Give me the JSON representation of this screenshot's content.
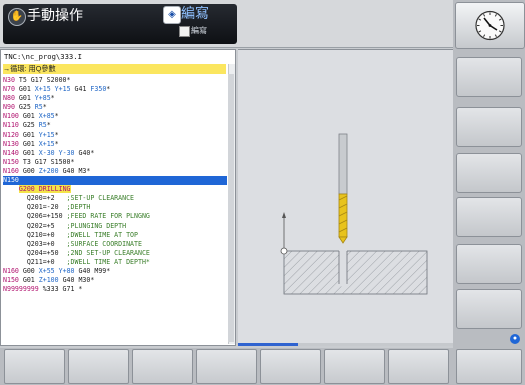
{
  "header": {
    "mode_title": "手動操作",
    "mode_icon": "hand-icon",
    "program_mode_title": "編寫",
    "program_mode_subtitle": "編寫",
    "program_mode_icon": "edit-arrow-icon"
  },
  "program": {
    "path": "TNC:\\nc_prog\\333.I",
    "comment_line": "→循環: 用Q參數",
    "lines_before": [
      {
        "blk": "N30",
        "rest": " T5 G17 S2000*"
      },
      {
        "blk": "N70",
        "rest": " G01 X+15 Y+15 G41 F350*"
      },
      {
        "blk": "N80",
        "rest": " G01 Y+85*"
      },
      {
        "blk": "N90",
        "rest": " G25 R5*"
      },
      {
        "blk": "N100",
        "rest": " G01 X+85*"
      },
      {
        "blk": "N110",
        "rest": " G25 R5*"
      },
      {
        "blk": "N120",
        "rest": " G01 Y+15*"
      },
      {
        "blk": "N130",
        "rest": " G01 X+15*"
      },
      {
        "blk": "N140",
        "rest": " G01 X-30 Y-30 G40*"
      },
      {
        "blk": "N150",
        "rest": " T3 G17 S1500*"
      },
      {
        "blk": "N160",
        "rest": " G00 Z+200 G40 M3*"
      }
    ],
    "selected_line": "N150",
    "cycle_header": "G200",
    "cycle_name": " DRILLING",
    "cycle_params": [
      {
        "q": "Q200=+2  ",
        "c": ";SET-UP CLEARANCE"
      },
      {
        "q": "Q201=-20 ",
        "c": ";DEPTH"
      },
      {
        "q": "Q206=+150",
        "c": ";FEED RATE FOR PLNGNG"
      },
      {
        "q": "Q202=+5  ",
        "c": ";PLUNGING DEPTH"
      },
      {
        "q": "Q210=+0  ",
        "c": ";DWELL TIME AT TOP"
      },
      {
        "q": "Q203=+0  ",
        "c": ";SURFACE COORDINATE"
      },
      {
        "q": "Q204=+50 ",
        "c": ";2ND SET-UP CLEARANCE"
      },
      {
        "q": "Q211=+0  ",
        "c": ";DWELL TIME AT DEPTH*"
      }
    ],
    "lines_after": [
      {
        "blk": "N160",
        "rest": " G00 X+55 Y+80 G40 M99*"
      },
      {
        "blk": "N150",
        "rest": " G01 Z+100 G40 M30*"
      },
      {
        "blk": "N99999999",
        "rest": " %333 G71 *"
      }
    ]
  },
  "graphic": {
    "drill_color": "#e8c31c",
    "tool_label": "drill-bit-icon"
  },
  "icons": {
    "clock": "clock-icon",
    "help": "help-icon"
  },
  "colors": {
    "block_number": "#b0126e",
    "selection": "#1f66d6",
    "comment_bar": "#fbe65f",
    "cycle_comment": "#3b7f2b"
  }
}
